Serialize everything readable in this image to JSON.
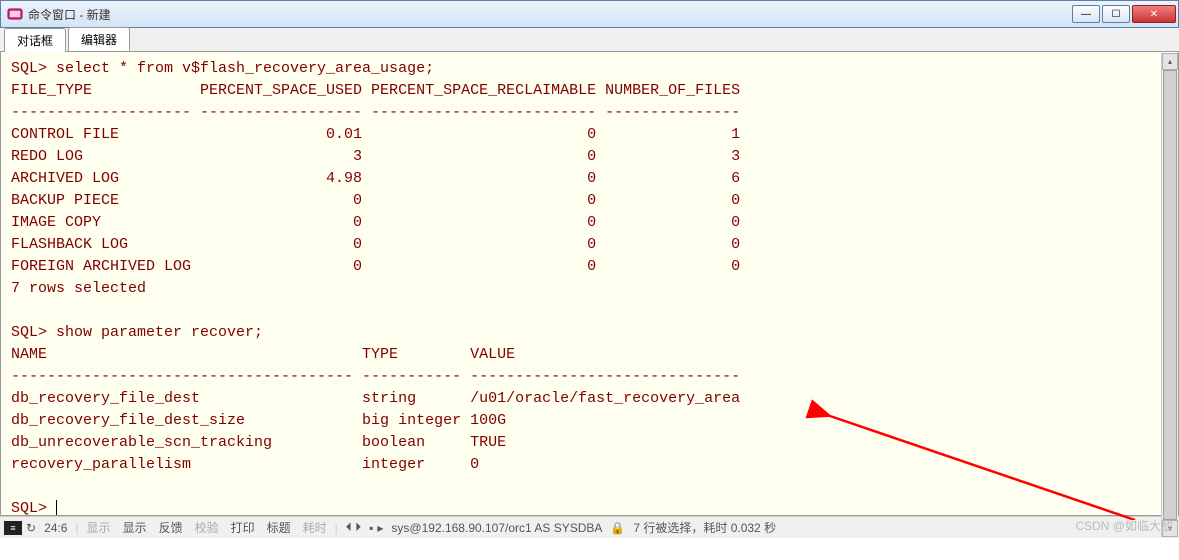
{
  "window": {
    "title": "命令窗口 - 新建"
  },
  "win_buttons": {
    "min": "—",
    "max": "☐",
    "close": "✕"
  },
  "tabs": {
    "dialog": "对话框",
    "editor": "编辑器"
  },
  "sql_lines": {
    "l1": "SQL> select * from v$flash_recovery_area_usage;",
    "l2": "FILE_TYPE            PERCENT_SPACE_USED PERCENT_SPACE_RECLAIMABLE NUMBER_OF_FILES",
    "l3": "-------------------- ------------------ ------------------------- ---------------",
    "r1": "CONTROL FILE                       0.01                         0               1",
    "r2": "REDO LOG                              3                         0               3",
    "r3": "ARCHIVED LOG                       4.98                         0               6",
    "r4": "BACKUP PIECE                          0                         0               0",
    "r5": "IMAGE COPY                            0                         0               0",
    "r6": "FLASHBACK LOG                         0                         0               0",
    "r7": "FOREIGN ARCHIVED LOG                  0                         0               0",
    "sel": "7 rows selected",
    "blank": "",
    "l4": "SQL> show parameter recover;",
    "l5": "NAME                                   TYPE        VALUE",
    "l6": "-------------------------------------- ----------- ------------------------------",
    "p1": "db_recovery_file_dest                  string      /u01/oracle/fast_recovery_area",
    "p2": "db_recovery_file_dest_size             big integer 100G",
    "p3": "db_unrecoverable_scn_tracking          boolean     TRUE",
    "p4": "recovery_parallelism                   integer     0",
    "prompt": "SQL> "
  },
  "status": {
    "pos": "24:6",
    "show1": "显示",
    "show2": "显示",
    "feedback": "反馈",
    "check": "校验",
    "print": "打印",
    "title": "标题",
    "time": "耗时",
    "arrows": "⏴ ⏵",
    "bullet": "▪",
    "play": "▸",
    "conn": "sys@192.168.90.107/orc1 AS SYSDBA",
    "lock": "🔒",
    "msg": "7 行被选择，耗时 0.032 秒"
  },
  "watermark": "CSDN @如临大敌"
}
